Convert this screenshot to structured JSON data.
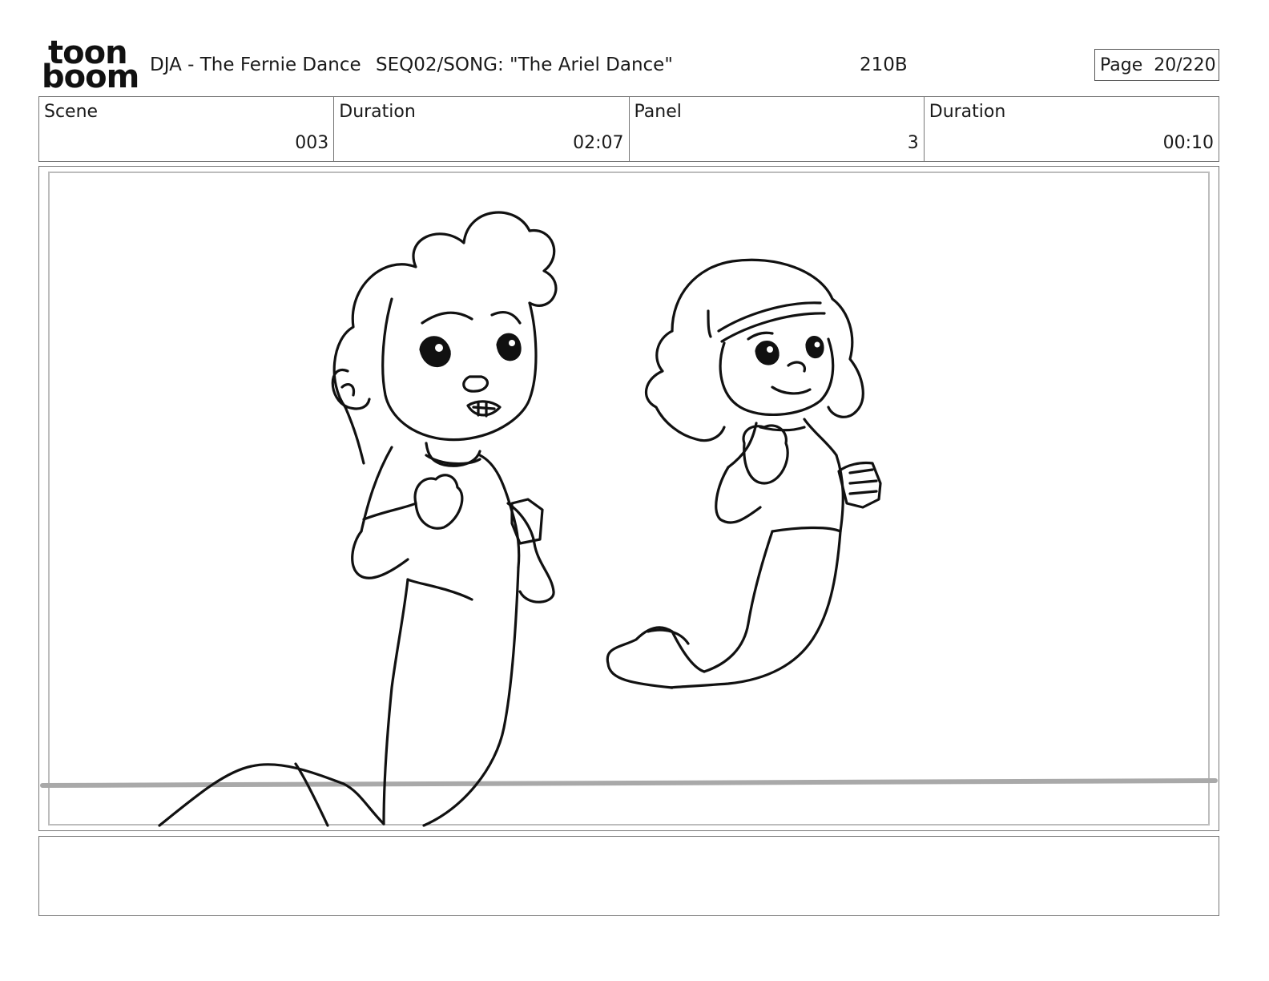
{
  "header": {
    "logo_line1": "toon",
    "logo_line2": "boom",
    "project_title": "DJA - The Fernie Dance",
    "sequence": "SEQ02/SONG: \"The Ariel Dance\"",
    "code": "210B",
    "page_label": "Page",
    "page_value": "20/220"
  },
  "info": {
    "scene_label": "Scene",
    "scene_value": "003",
    "duration_label": "Duration",
    "duration_value": "02:07",
    "panel_label": "Panel",
    "panel_value": "3",
    "panel_duration_label": "Duration",
    "panel_duration_value": "00:10"
  },
  "panel": {
    "drawing": "storyboard sketch of a boy merman and a girl mermaid dancing",
    "line_color": "#111111",
    "ground_color": "#a9a9a9"
  },
  "notes": {
    "text": ""
  }
}
